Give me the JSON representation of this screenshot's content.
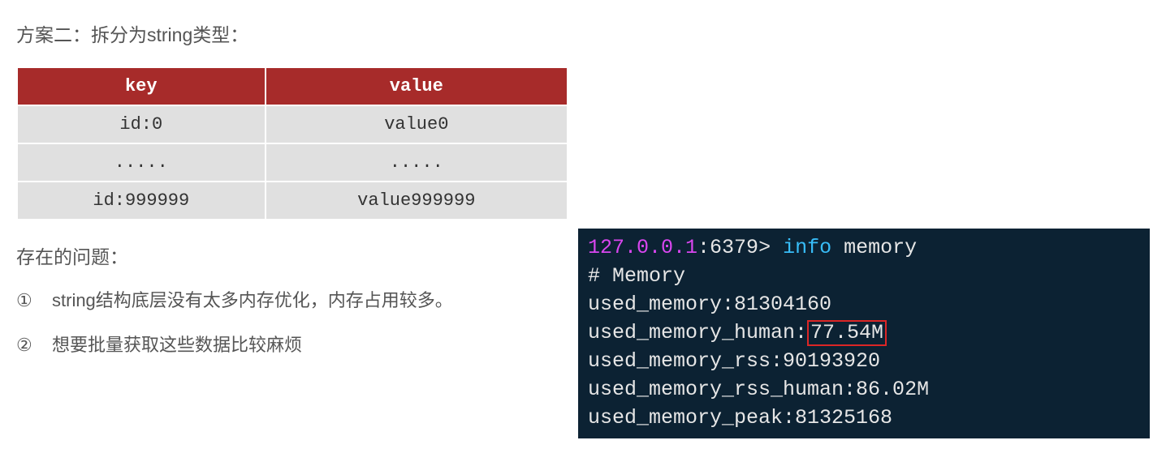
{
  "title": "方案二：拆分为string类型：",
  "table": {
    "headers": {
      "key": "key",
      "value": "value"
    },
    "rows": [
      {
        "key": "id:0",
        "value": "value0"
      },
      {
        "key": ".....",
        "value": "....."
      },
      {
        "key": "id:999999",
        "value": "value999999"
      }
    ]
  },
  "problems": {
    "title": "存在的问题：",
    "items": [
      {
        "num": "①",
        "text": "string结构底层没有太多内存优化，内存占用较多。"
      },
      {
        "num": "②",
        "text": "想要批量获取这些数据比较麻烦"
      }
    ]
  },
  "terminal": {
    "ip": "127.0.0.1",
    "port": "6379",
    "prompt_char": ">",
    "command": "info",
    "arg": "memory",
    "lines": [
      "# Memory",
      "used_memory:81304160",
      "used_memory_human:",
      "used_memory_rss:90193920",
      "used_memory_rss_human:86.02M",
      "used_memory_peak:81325168"
    ],
    "highlighted_value": "77.54M"
  }
}
